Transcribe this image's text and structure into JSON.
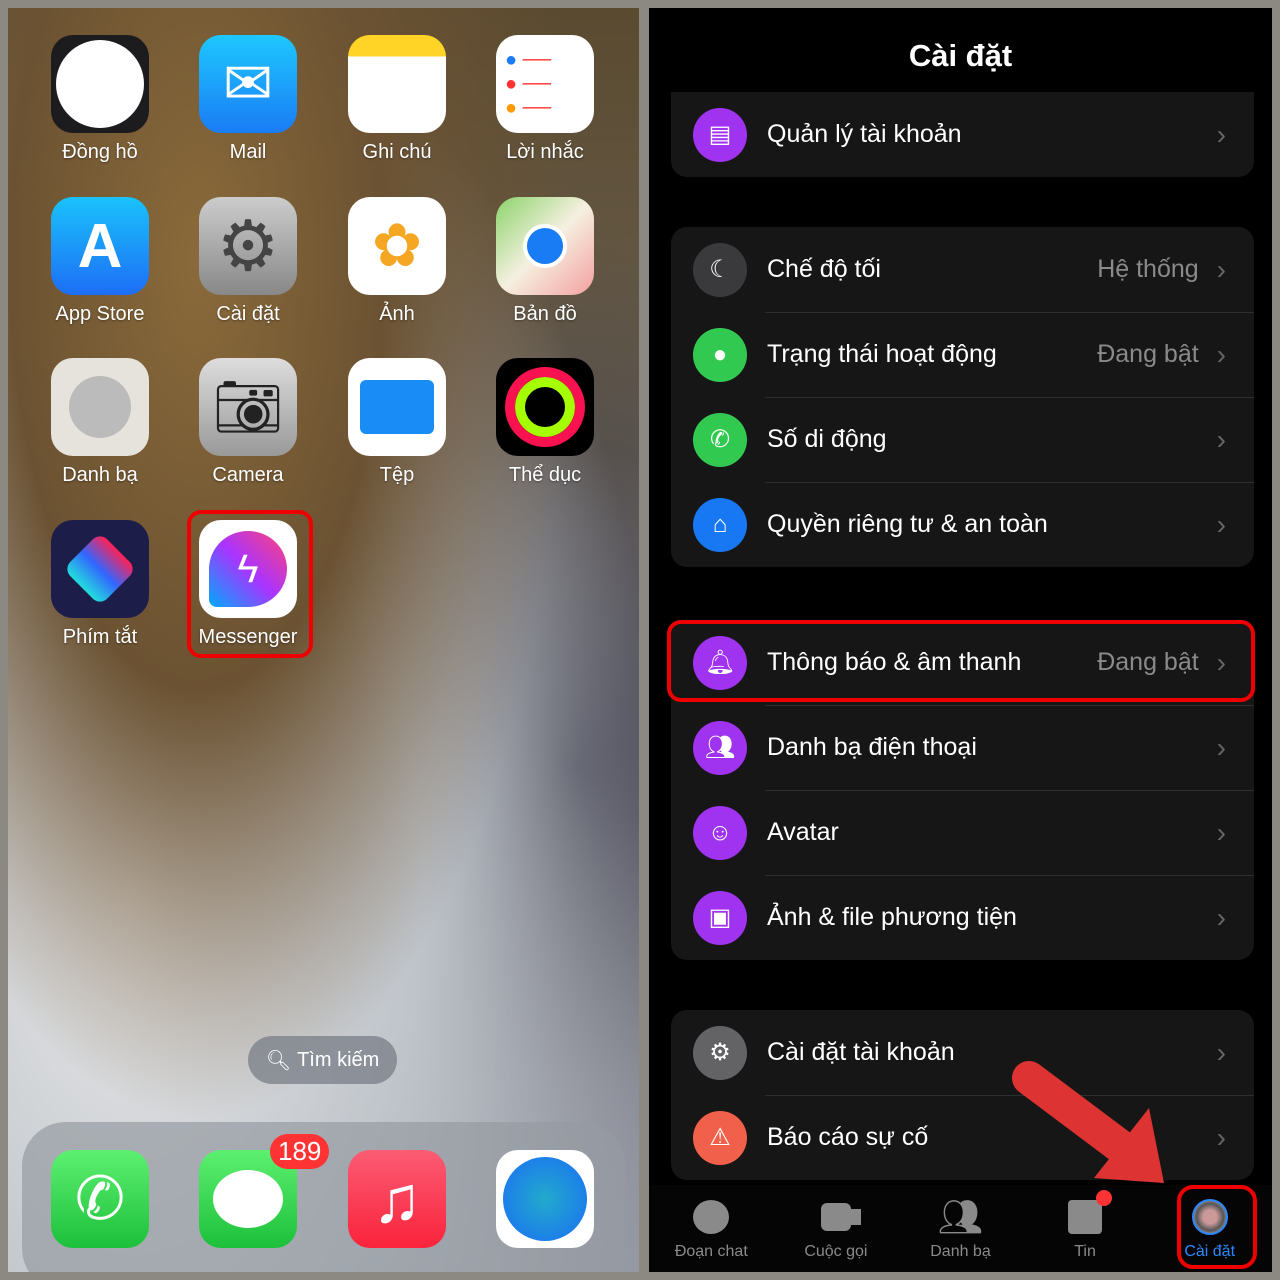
{
  "home": {
    "apps": [
      {
        "label": "Đồng hồ",
        "icon": "clock-icon"
      },
      {
        "label": "Mail",
        "icon": "mail-icon"
      },
      {
        "label": "Ghi chú",
        "icon": "notes-icon"
      },
      {
        "label": "Lời nhắc",
        "icon": "reminders-icon"
      },
      {
        "label": "App Store",
        "icon": "app-store-icon"
      },
      {
        "label": "Cài đặt",
        "icon": "settings-gear-icon"
      },
      {
        "label": "Ảnh",
        "icon": "photos-icon"
      },
      {
        "label": "Bản đồ",
        "icon": "maps-icon"
      },
      {
        "label": "Danh bạ",
        "icon": "contacts-icon"
      },
      {
        "label": "Camera",
        "icon": "camera-icon"
      },
      {
        "label": "Tệp",
        "icon": "files-icon"
      },
      {
        "label": "Thể dục",
        "icon": "fitness-icon"
      },
      {
        "label": "Phím tắt",
        "icon": "shortcuts-icon"
      },
      {
        "label": "Messenger",
        "icon": "messenger-icon"
      }
    ],
    "search_label": "Tìm kiếm",
    "dock": [
      {
        "icon": "phone-icon"
      },
      {
        "icon": "messages-icon",
        "badge": "189"
      },
      {
        "icon": "music-icon"
      },
      {
        "icon": "safari-icon"
      }
    ]
  },
  "settings": {
    "title": "Cài đặt",
    "groups": [
      [
        {
          "label": "Quản lý tài khoản",
          "color": "#a033f0",
          "icon": "account-icon"
        }
      ],
      [
        {
          "label": "Chế độ tối",
          "value": "Hệ thống",
          "color": "#3a3a3c",
          "icon": "moon-icon"
        },
        {
          "label": "Trạng thái hoạt động",
          "value": "Đang bật",
          "color": "#31c950",
          "icon": "active-status-icon"
        },
        {
          "label": "Số di động",
          "color": "#31c950",
          "icon": "phone-icon"
        },
        {
          "label": "Quyền riêng tư & an toàn",
          "color": "#1877f2",
          "icon": "privacy-home-icon"
        }
      ],
      [
        {
          "label": "Thông báo & âm thanh",
          "value": "Đang bật",
          "color": "#a033f0",
          "icon": "bell-icon"
        },
        {
          "label": "Danh bạ điện thoại",
          "color": "#a033f0",
          "icon": "contacts-icon"
        },
        {
          "label": "Avatar",
          "color": "#a033f0",
          "icon": "avatar-icon"
        },
        {
          "label": "Ảnh & file phương tiện",
          "color": "#a033f0",
          "icon": "image-icon"
        }
      ],
      [
        {
          "label": "Cài đặt tài khoản",
          "color": "#636366",
          "icon": "gear-icon"
        },
        {
          "label": "Báo cáo sự cố",
          "color": "#f0604a",
          "icon": "warning-icon"
        }
      ]
    ],
    "tabs": [
      {
        "label": "Đoạn chat",
        "icon": "chat-icon"
      },
      {
        "label": "Cuộc gọi",
        "icon": "video-icon"
      },
      {
        "label": "Danh bạ",
        "icon": "people-icon"
      },
      {
        "label": "Tin",
        "icon": "stories-icon"
      },
      {
        "label": "Cài đặt",
        "icon": "profile-avatar-icon",
        "active": true
      }
    ],
    "accent": "#2d88ff",
    "highlight": "#e00000"
  }
}
